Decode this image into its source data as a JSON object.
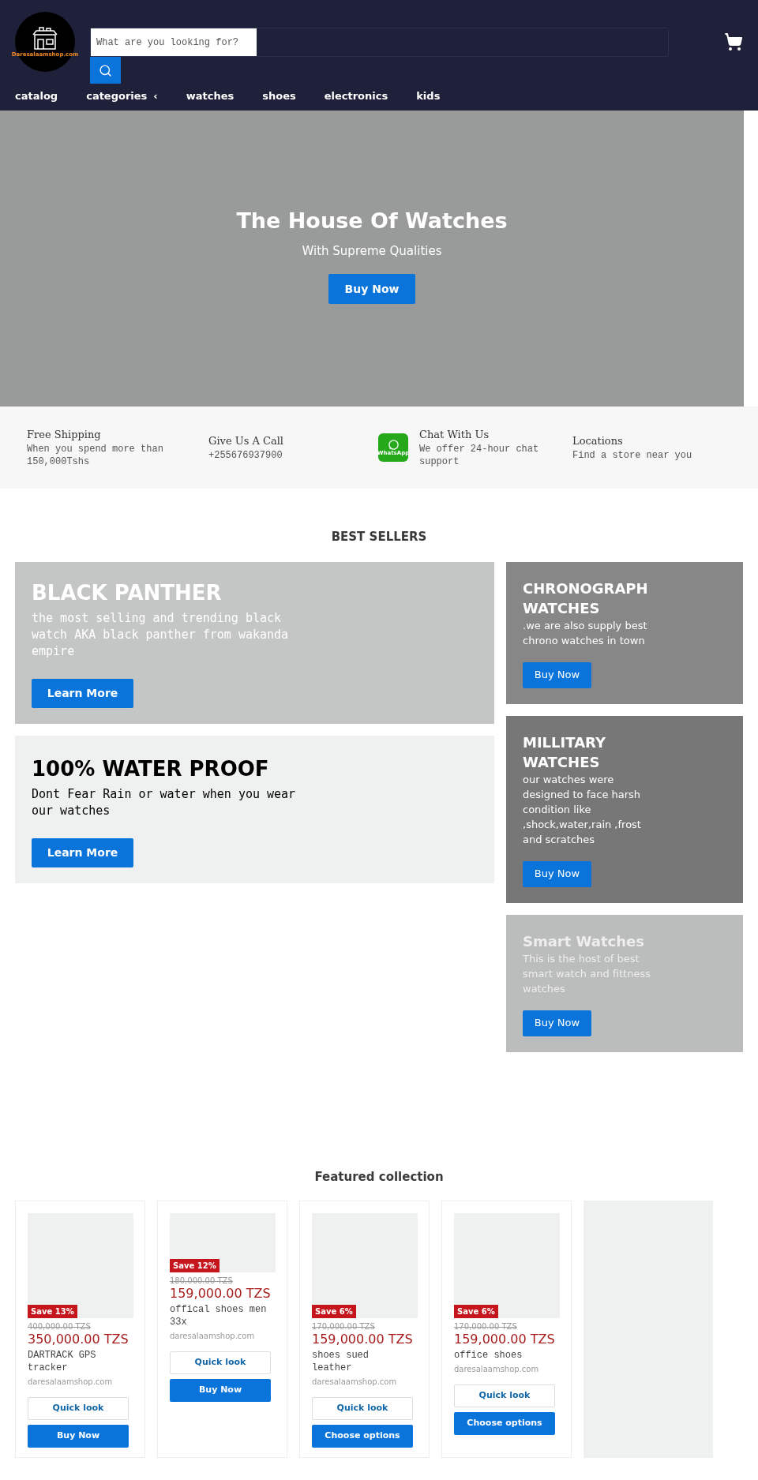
{
  "header": {
    "logo_text": "Daresalaamshop.com",
    "search": {
      "placeholder": "What are you looking for?"
    },
    "nav": [
      {
        "label": "catalog"
      },
      {
        "label": "categories",
        "caret": "‹"
      },
      {
        "label": "watches"
      },
      {
        "label": "shoes"
      },
      {
        "label": "electronics"
      },
      {
        "label": "kids"
      }
    ]
  },
  "hero": {
    "title": "The House Of Watches",
    "subtitle": "With Supreme Qualities",
    "button": "Buy Now"
  },
  "features": [
    {
      "title": "Free Shipping",
      "text": "When you spend more than 150,000Tshs"
    },
    {
      "title": "Give Us A Call",
      "text": "+255676937900"
    },
    {
      "kind": "whatsapp",
      "icon_text": "WhatsApp",
      "title": "Chat With Us",
      "text": "We offer 24-hour chat support"
    },
    {
      "title": "Locations",
      "text": "Find a store near you"
    }
  ],
  "best_sellers": {
    "title": "BEST SELLERS",
    "left": [
      {
        "title": "BLACK PANTHER",
        "text": "the most selling and trending black watch AKA black panther from wakanda empire",
        "button": "Learn More"
      },
      {
        "title": "100% WATER PROOF",
        "text": "Dont Fear Rain or water when you wear our watches",
        "button": "Learn More"
      }
    ],
    "right": [
      {
        "title": "CHRONOGRAPH WATCHES",
        "text": ".we are also supply best chrono watches in town",
        "button": "Buy Now"
      },
      {
        "title": "MILLITARY WATCHES",
        "text": "our watches were designed to face harsh condition like ,shock,water,rain ,frost and scratches",
        "button": "Buy Now"
      },
      {
        "title": "Smart Watches",
        "text": "This is the host of best smart watch and fittness watches",
        "button": "Buy Now"
      }
    ]
  },
  "featured": {
    "title": "Featured collection",
    "products": [
      {
        "kind": "tall",
        "badge": "Save 13%",
        "old_price": "400,000.00 TZS",
        "price": "350,000.00 TZS",
        "name": "DARTRACK GPS tracker",
        "vendor": "daresalaamshop.com",
        "buttons": [
          "Quick look",
          "Buy Now"
        ]
      },
      {
        "kind": "short",
        "badge": "Save 12%",
        "old_price": "180,000.00 TZS",
        "price": "159,000.00 TZS",
        "name": "offical shoes men 33x",
        "vendor": "daresalaamshop.com",
        "buttons": [
          "Quick look",
          "Buy Now"
        ]
      },
      {
        "kind": "tall",
        "badge": "Save 6%",
        "old_price": "170,000.00 TZS",
        "price": "159,000.00 TZS",
        "name": "shoes sued leather",
        "vendor": "daresalaamshop.com",
        "buttons": [
          "Quick look",
          "Choose options"
        ]
      },
      {
        "kind": "tall",
        "badge": "Save 6%",
        "old_price": "170,000.00 TZS",
        "price": "159,000.00 TZS",
        "name": "office shoes",
        "vendor": "daresalaamshop.com",
        "buttons": [
          "Quick look",
          "Choose options"
        ]
      },
      {
        "kind": "placeholder"
      }
    ]
  }
}
